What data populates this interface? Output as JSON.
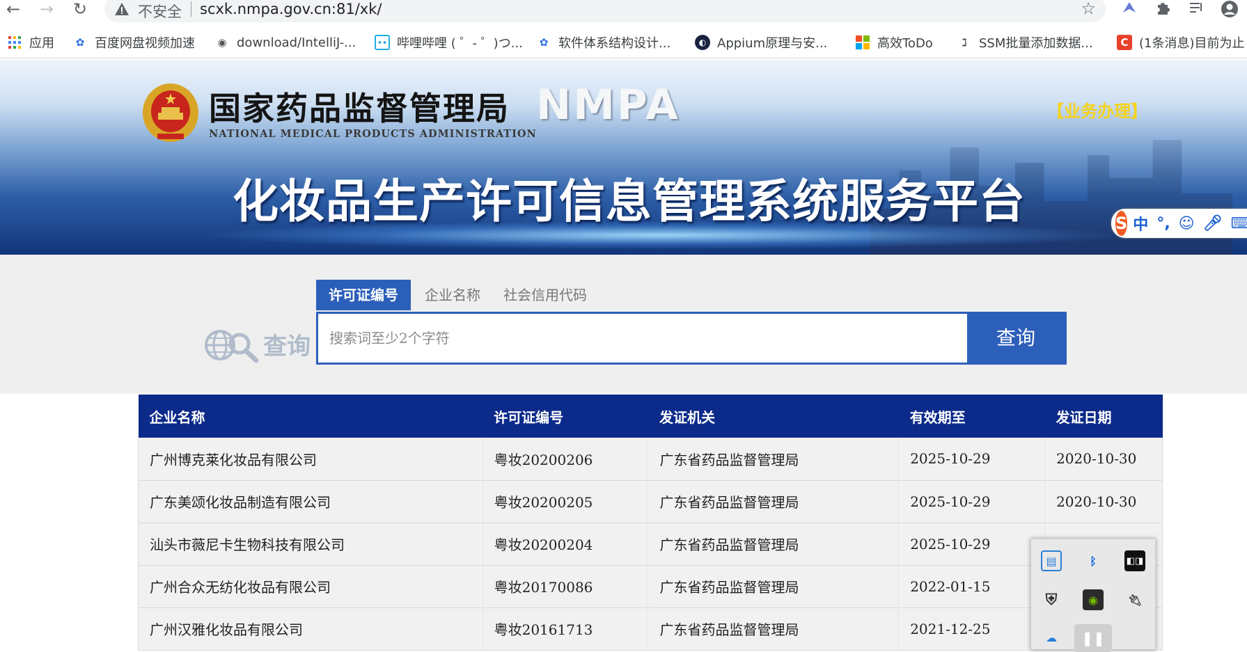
{
  "browser": {
    "security_label": "不安全",
    "url": "scxk.nmpa.gov.cn:81/xk/",
    "bookmarks": [
      {
        "label": "应用",
        "icon": "apps-grid-icon"
      },
      {
        "label": "百度网盘视频加速",
        "icon": "baidu-paw-icon"
      },
      {
        "label": "download/IntelliJ-...",
        "icon": "globe-icon"
      },
      {
        "label": "哔哩哔哩 ( ゜- ゜)つ...",
        "icon": "bilibili-icon"
      },
      {
        "label": "软件体系结构设计...",
        "icon": "baidu-paw-icon"
      },
      {
        "label": "Appium原理与安...",
        "icon": "appium-icon"
      },
      {
        "label": "高效ToDo",
        "icon": "microsoft-icon"
      },
      {
        "label": "SSM批量添加数据...",
        "icon": "bookmark-page-icon"
      },
      {
        "label": "(1条消息)目前为止",
        "icon": "csdn-icon"
      }
    ]
  },
  "banner": {
    "cn_name": "国家药品监督管理局",
    "en_name": "NATIONAL MEDICAL PRODUCTS ADMINISTRATION",
    "abbr": "NMPA",
    "business_link": "【业务办理】",
    "platform_title": "化妆品生产许可信息管理系统服务平台",
    "ime_glyph": "中"
  },
  "search": {
    "logo_text": "查询",
    "tabs": [
      {
        "label": "许可证编号",
        "active": true
      },
      {
        "label": "企业名称",
        "active": false
      },
      {
        "label": "社会信用代码",
        "active": false
      }
    ],
    "placeholder": "搜索词至少2个字符",
    "button_label": "查询"
  },
  "table": {
    "columns": [
      "企业名称",
      "许可证编号",
      "发证机关",
      "有效期至",
      "发证日期"
    ],
    "rows": [
      [
        "广州博克莱化妆品有限公司",
        "粤妆20200206",
        "广东省药品监督管理局",
        "2025-10-29",
        "2020-10-30"
      ],
      [
        "广东美颂化妆品制造有限公司",
        "粤妆20200205",
        "广东省药品监督管理局",
        "2025-10-29",
        "2020-10-30"
      ],
      [
        "汕头市薇尼卡生物科技有限公司",
        "粤妆20200204",
        "广东省药品监督管理局",
        "2025-10-29",
        ""
      ],
      [
        "广州合众无纺化妆品有限公司",
        "粤妆20170086",
        "广东省药品监督管理局",
        "2022-01-15",
        ""
      ],
      [
        "广州汉雅化妆品有限公司",
        "粤妆20161713",
        "广东省药品监督管理局",
        "2021-12-25",
        ""
      ]
    ]
  }
}
